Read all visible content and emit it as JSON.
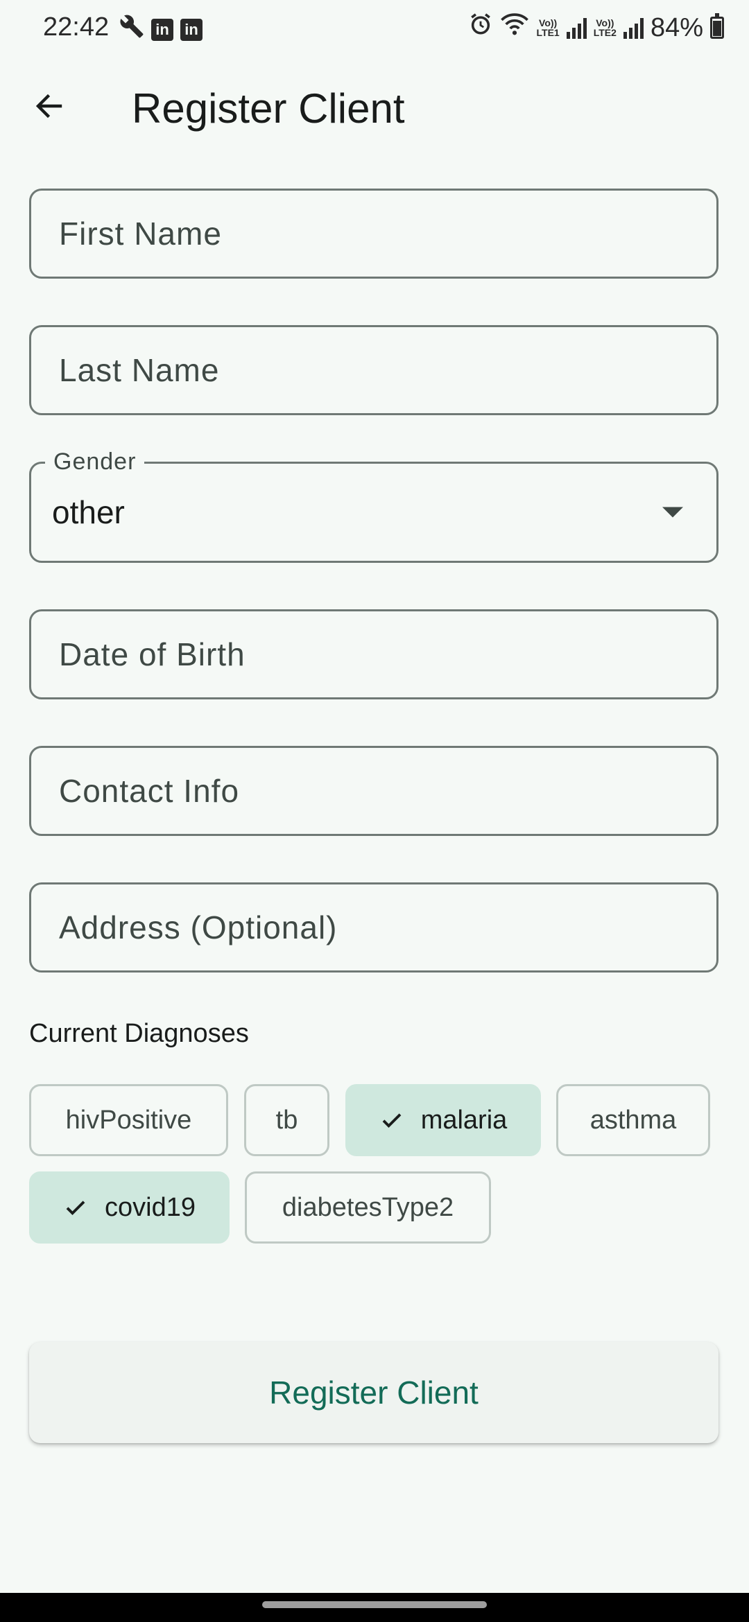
{
  "status_bar": {
    "time": "22:42",
    "battery": "84%",
    "battery_level": 0.84,
    "icons": [
      "wrench-icon",
      "linkedin-icon",
      "linkedin-icon",
      "alarm-icon",
      "wifi-icon",
      "signal-icon",
      "signal-icon",
      "battery-icon"
    ],
    "sim1_label": "LTE1",
    "sim2_label": "LTE2",
    "volte_label": "Vo))"
  },
  "app_bar": {
    "title": "Register Client",
    "back_icon": "arrow-back-icon"
  },
  "form": {
    "first_name": {
      "placeholder": "First Name",
      "value": ""
    },
    "last_name": {
      "placeholder": "Last Name",
      "value": ""
    },
    "gender": {
      "label": "Gender",
      "value": "other"
    },
    "date_of_birth": {
      "placeholder": "Date of Birth",
      "value": ""
    },
    "contact_info": {
      "placeholder": "Contact Info",
      "value": ""
    },
    "address": {
      "placeholder": "Address (Optional)",
      "value": ""
    }
  },
  "diagnoses": {
    "label": "Current Diagnoses",
    "chips": [
      {
        "label": "hivPositive",
        "selected": false
      },
      {
        "label": "tb",
        "selected": false
      },
      {
        "label": "malaria",
        "selected": true
      },
      {
        "label": "asthma",
        "selected": false
      },
      {
        "label": "covid19",
        "selected": true
      },
      {
        "label": "diabetesType2",
        "selected": false
      }
    ]
  },
  "submit": {
    "label": "Register Client"
  },
  "colors": {
    "background": "#f5f9f6",
    "primary": "#136b57",
    "chip_selected": "#cfe8de",
    "outline": "#6f7975"
  }
}
